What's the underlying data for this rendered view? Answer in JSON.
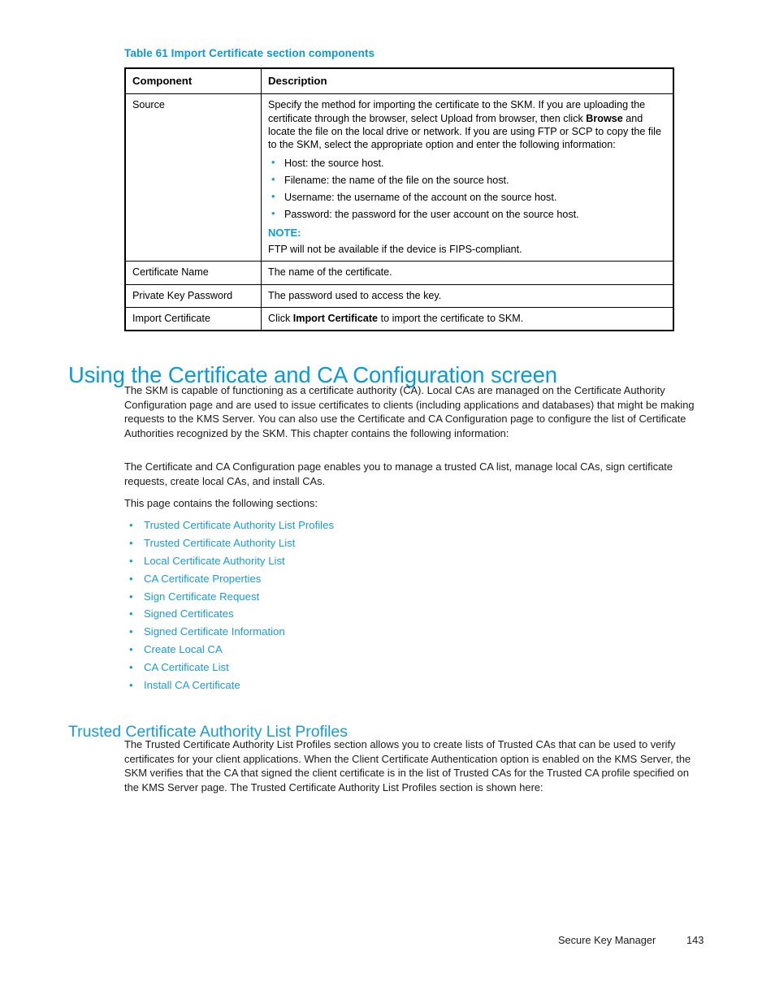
{
  "table": {
    "caption": "Table 61 Import Certificate section components",
    "headers": [
      "Component",
      "Description"
    ],
    "rows": [
      {
        "component": "Source",
        "description_intro": "Specify the method for importing the certificate to the SKM. If you are uploading the certificate through the browser, select Upload from browser, then click ",
        "description_bold": "Browse",
        "description_intro_2": " and locate the file on the local drive or network. If you are using FTP or SCP to copy the file to the SKM, select the appropriate option and enter the following information:",
        "bullets": [
          "Host:  the source host.",
          "Filename:  the name of the file on the source host.",
          "Username:  the username of the account on the source host.",
          "Password:  the password for the user account on the source host."
        ],
        "note_label": "NOTE:",
        "note_text": "FTP will not be available if the device is FIPS-compliant."
      },
      {
        "component": "Certificate Name",
        "description": "The name of the certificate."
      },
      {
        "component": "Private Key Password",
        "description": "The password used to access the key."
      },
      {
        "component": "Import Certificate",
        "description_pre": "Click ",
        "description_bold": "Import Certificate",
        "description_post": " to import the certificate to SKM."
      }
    ]
  },
  "heading_1": "Using the Certificate and CA Configuration screen",
  "paragraphs": {
    "p1": "The SKM is capable of functioning as a certificate authority (CA). Local CAs are managed on the Certificate Authority Configuration page and are used to issue certificates to clients (including applications and databases) that might be making requests to the KMS Server.  You can also use the Certificate and CA Configuration page to configure the list of Certificate Authorities recognized by the SKM. This chapter contains the following information:",
    "p2": "The Certificate and CA Configuration page enables you to manage a trusted CA list, manage local CAs, sign certificate requests, create local CAs, and install CAs.",
    "p3": "This page contains the following sections:",
    "p4": "The Trusted Certificate Authority List Profiles section allows you to create lists of Trusted CAs that can be used to verify certificates for your client applications.  When the Client Certificate Authentication option is enabled on the KMS Server, the SKM verifies that the CA that signed the client certificate is in the list of Trusted CAs for the Trusted CA profile specified on the KMS Server page.  The Trusted Certificate Authority List Profiles section is shown here:"
  },
  "section_links": [
    "Trusted Certificate Authority List Profiles",
    "Trusted Certificate Authority List",
    "Local Certificate Authority List",
    "CA Certificate Properties",
    "Sign Certificate Request",
    "Signed Certificates",
    "Signed Certificate Information",
    "Create Local CA",
    "CA Certificate List",
    "Install CA Certificate"
  ],
  "heading_2": "Trusted Certificate Authority List Profiles",
  "footer": {
    "title": "Secure Key Manager",
    "page_number": "143"
  },
  "colors": {
    "accent_blue": "#0b9ad6",
    "link_blue": "#1b9bd8",
    "text": "#1a1a1a"
  }
}
